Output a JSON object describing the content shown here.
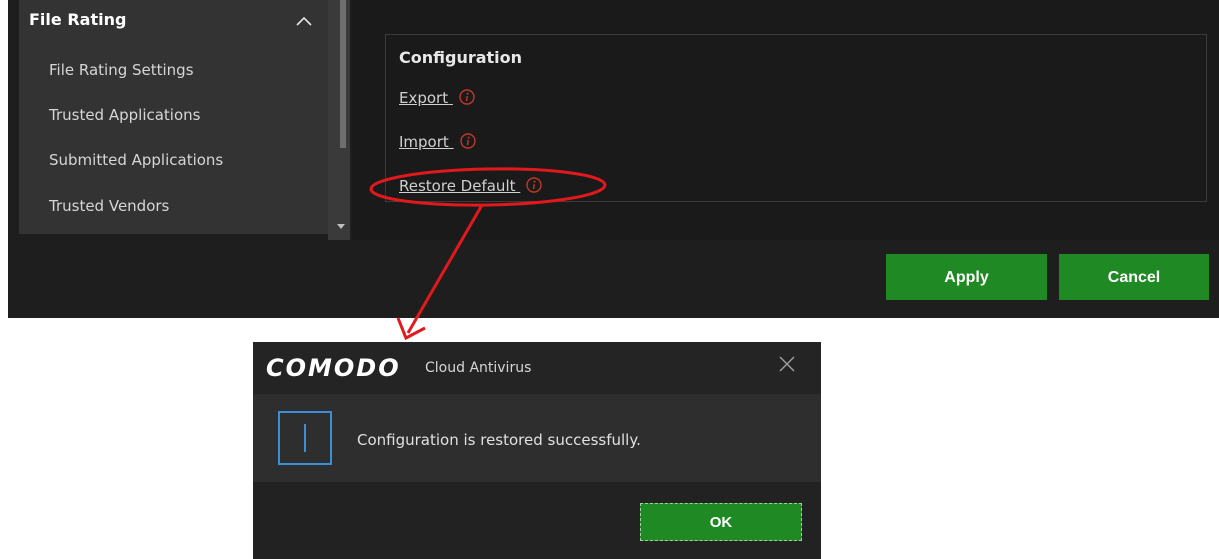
{
  "sidebar": {
    "header": "File Rating",
    "items": [
      {
        "label": "File Rating Settings"
      },
      {
        "label": "Trusted Applications"
      },
      {
        "label": "Submitted Applications"
      },
      {
        "label": "Trusted Vendors"
      }
    ]
  },
  "main": {
    "section_title": "Configuration",
    "links": [
      {
        "label": "Export"
      },
      {
        "label": "Import"
      },
      {
        "label": "Restore Default"
      }
    ]
  },
  "footer": {
    "apply_label": "Apply",
    "cancel_label": "Cancel"
  },
  "dialog": {
    "brand": "COMODO",
    "product": "Cloud Antivirus",
    "message": "Configuration is restored successfully.",
    "ok_label": "OK"
  },
  "icons": {
    "info": "info-icon",
    "close": "close-icon",
    "collapse": "chevron-up-icon"
  },
  "colors": {
    "accent_green": "#1f8a24",
    "info_red": "#c0392b",
    "info_blue": "#3c8fd6",
    "annotation_red": "#e1191c"
  }
}
